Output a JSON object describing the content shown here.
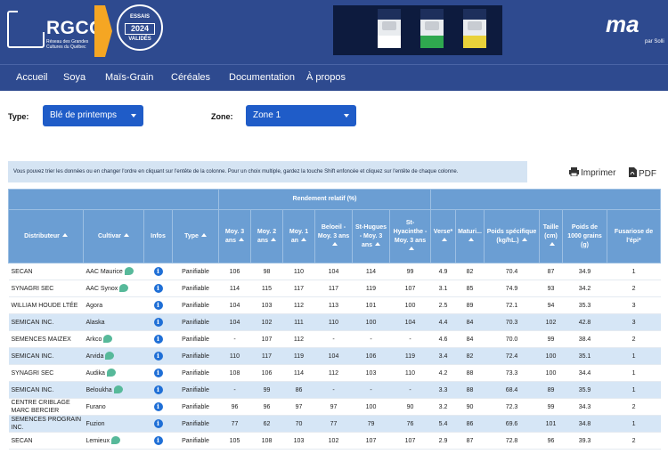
{
  "header": {
    "logo_text": "RGCQ",
    "logo_sub": "Réseau des Grandes Cultures du Québec",
    "badge_top": "ESSAIS",
    "badge_year": "2024",
    "badge_bottom": "VALIDÉS",
    "brand": "ma",
    "brand_sub": "par Solli"
  },
  "nav": {
    "items": [
      "Accueil",
      "Soya",
      "Maïs-Grain",
      "Céréales",
      "Documentation",
      "À propos"
    ]
  },
  "filters": {
    "type_label": "Type:",
    "type_value": "Blé de printemps",
    "zone_label": "Zone:",
    "zone_value": "Zone 1"
  },
  "notice": "Vous pouvez trier les données ou en changer l'ordre en cliquant sur l'entête de la colonne. Pour un choix multiple, gardez la touche Shift enfoncée et cliquez sur l'entête de chaque colonne.",
  "tools": {
    "print": "Imprimer",
    "pdf": "PDF"
  },
  "table": {
    "group_header": "Rendement relatif (%)",
    "columns": [
      "Distributeur",
      "Cultivar",
      "Infos",
      "Type",
      "Moy. 3 ans",
      "Moy. 2 ans",
      "Moy. 1 an",
      "Beloeil - Moy. 3 ans",
      "St-Hugues - Moy. 3 ans",
      "St-Hyacinthe - Moy. 3 ans",
      "Verse*",
      "Maturi...",
      "Poids spécifique (kg/hL.)",
      "Taille (cm)",
      "Poids de 1000 grains (g)",
      "Fusariose de l'épi*"
    ],
    "rows": [
      {
        "dist": "SECAN",
        "cult": "AAC Maurice",
        "tag": true,
        "info": "i",
        "type": "Panifiable",
        "v": [
          "106",
          "98",
          "110",
          "104",
          "114",
          "99",
          "4.9",
          "82",
          "70.4",
          "87",
          "34.9",
          "1"
        ],
        "link": true,
        "hl": false
      },
      {
        "dist": "SYNAGRI SEC",
        "cult": "AAC Synox",
        "tag": true,
        "info": "i",
        "type": "Panifiable",
        "v": [
          "114",
          "115",
          "117",
          "117",
          "119",
          "107",
          "3.1",
          "85",
          "74.9",
          "93",
          "34.2",
          "2"
        ],
        "link": false,
        "hl": false
      },
      {
        "dist": "WILLIAM HOUDE LTÉE",
        "cult": "Agora",
        "tag": false,
        "info": "i",
        "type": "Panifiable",
        "v": [
          "104",
          "103",
          "112",
          "113",
          "101",
          "100",
          "2.5",
          "89",
          "72.1",
          "94",
          "35.3",
          "3"
        ],
        "link": false,
        "hl": false
      },
      {
        "dist": "SEMICAN INC.",
        "cult": "Alaska",
        "tag": false,
        "info": "i",
        "type": "Panifiable",
        "v": [
          "104",
          "102",
          "111",
          "110",
          "100",
          "104",
          "4.4",
          "84",
          "70.3",
          "102",
          "42.8",
          "3"
        ],
        "link": true,
        "hl": true
      },
      {
        "dist": "SEMENCES MAIZEX",
        "cult": "Arkco",
        "tag": true,
        "info": "i",
        "type": "Panifiable",
        "v": [
          "-",
          "107",
          "112",
          "-",
          "-",
          "-",
          "4.6",
          "84",
          "70.0",
          "99",
          "38.4",
          "2"
        ],
        "link": true,
        "hl": false
      },
      {
        "dist": "SEMICAN INC.",
        "cult": "Arvida",
        "tag": true,
        "info": "i",
        "type": "Panifiable",
        "v": [
          "110",
          "117",
          "119",
          "104",
          "106",
          "119",
          "3.4",
          "82",
          "72.4",
          "100",
          "35.1",
          "1"
        ],
        "link": true,
        "hl": true
      },
      {
        "dist": "SYNAGRI SEC",
        "cult": "Audika",
        "tag": true,
        "info": "i",
        "type": "Panifiable",
        "v": [
          "108",
          "106",
          "114",
          "112",
          "103",
          "110",
          "4.2",
          "88",
          "73.3",
          "100",
          "34.4",
          "1"
        ],
        "link": false,
        "hl": false
      },
      {
        "dist": "SEMICAN INC.",
        "cult": "Beloukha",
        "tag": true,
        "info": "i",
        "type": "Panifiable",
        "v": [
          "-",
          "99",
          "86",
          "-",
          "-",
          "-",
          "3.3",
          "88",
          "68.4",
          "89",
          "35.9",
          "1"
        ],
        "link": true,
        "hl": true
      },
      {
        "dist": "CENTRE CRIBLAGE MARC BERCIER",
        "cult": "Furano",
        "tag": false,
        "info": "i",
        "type": "Panifiable",
        "v": [
          "96",
          "96",
          "97",
          "97",
          "100",
          "90",
          "3.2",
          "90",
          "72.3",
          "99",
          "34.3",
          "2"
        ],
        "link": false,
        "hl": false
      },
      {
        "dist": "SEMENCES PROGRAIN INC.",
        "cult": "Fuzion",
        "tag": false,
        "info": "i",
        "type": "Panifiable",
        "v": [
          "77",
          "62",
          "70",
          "77",
          "79",
          "76",
          "5.4",
          "86",
          "69.6",
          "101",
          "34.8",
          "1"
        ],
        "link": false,
        "hl": true
      },
      {
        "dist": "SECAN",
        "cult": "Lemieux",
        "tag": true,
        "info": "i",
        "type": "Panifiable",
        "v": [
          "105",
          "108",
          "103",
          "102",
          "107",
          "107",
          "2.9",
          "87",
          "72.8",
          "96",
          "39.3",
          "2"
        ],
        "link": true,
        "hl": false
      }
    ]
  },
  "colors": {
    "header_bg": "#2e4a8f",
    "accent": "#f5a623",
    "select_bg": "#1f5cc8",
    "table_header": "#6b9ed3",
    "row_highlight": "#d6e6f6"
  }
}
